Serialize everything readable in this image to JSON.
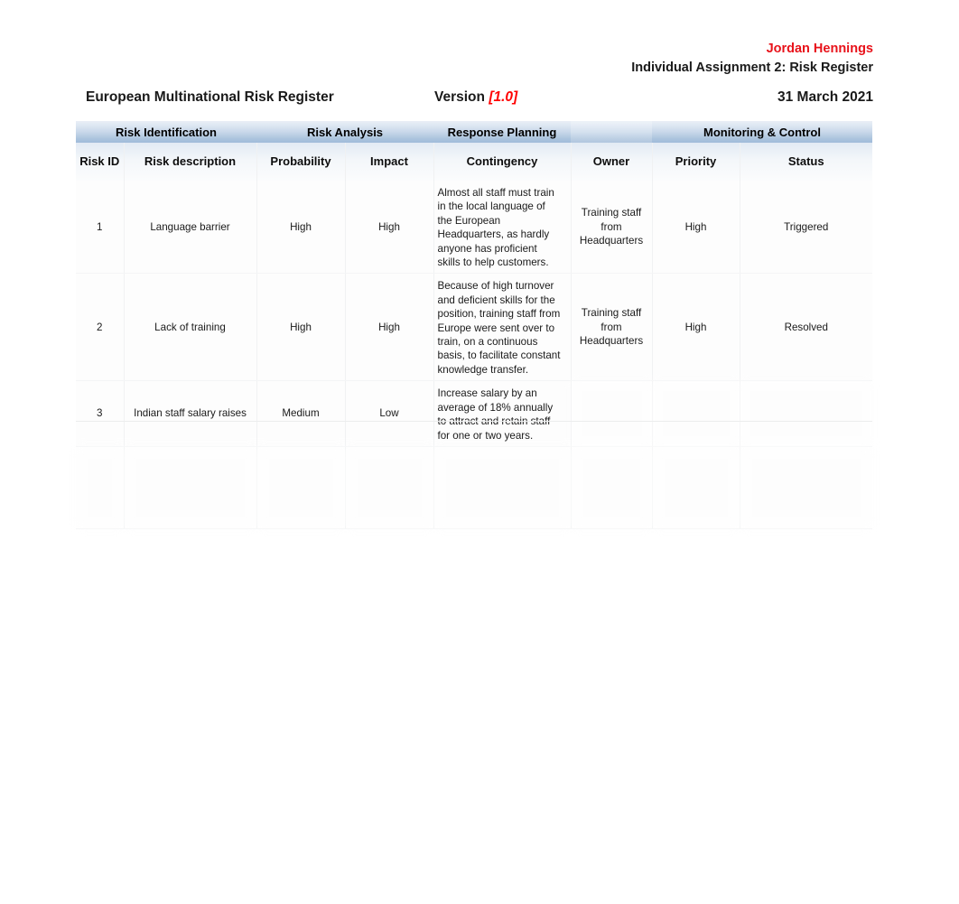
{
  "document": {
    "author": "Jordan Hennings",
    "assignment": "Individual Assignment 2: Risk Register",
    "title": "European Multinational Risk Register",
    "version_label": "Version",
    "version_value": "[1.0]",
    "date": "31 March 2021"
  },
  "colors": {
    "author_red": "#e8121a",
    "version_red": "#ff0000",
    "header_band_blue": "#9fbada",
    "body_text_red": "#f0464a"
  },
  "table": {
    "group_headers": [
      "Risk Identification",
      "Risk Analysis",
      "Response Planning",
      "Monitoring & Control"
    ],
    "columns": [
      "Risk ID",
      "Risk description",
      "Probability",
      "Impact",
      "Contingency",
      "Owner",
      "Priority",
      "Status"
    ],
    "rows": [
      {
        "id": "1",
        "description": "Language barrier",
        "probability": "High",
        "impact": "High",
        "contingency": "Almost all staff must train in the local language of the European Headquarters, as hardly anyone has proficient skills to help customers.",
        "owner": "Training staff from Headquarters",
        "priority": "High",
        "status": "Triggered",
        "redacted": false
      },
      {
        "id": "2",
        "description": "Lack of training",
        "probability": "High",
        "impact": "High",
        "contingency": "Because of high turnover and deficient skills for the position, training staff from Europe were sent over to train, on a continuous basis, to facilitate constant knowledge transfer.",
        "owner": "Training staff from Headquarters",
        "priority": "High",
        "status": "Resolved",
        "redacted": false
      },
      {
        "id": "3",
        "description": "Indian staff salary raises",
        "probability": "Medium",
        "impact": "Low",
        "contingency": "Increase salary by an average of 18% annually to attract and retain staff for one or two years.",
        "owner": "",
        "priority": "",
        "status": "",
        "redacted": false
      },
      {
        "id": "",
        "description": "",
        "probability": "",
        "impact": "",
        "contingency": "",
        "owner": "",
        "priority": "",
        "status": "",
        "redacted": true
      }
    ]
  },
  "body": {
    "heading": "",
    "paragraph": ""
  }
}
